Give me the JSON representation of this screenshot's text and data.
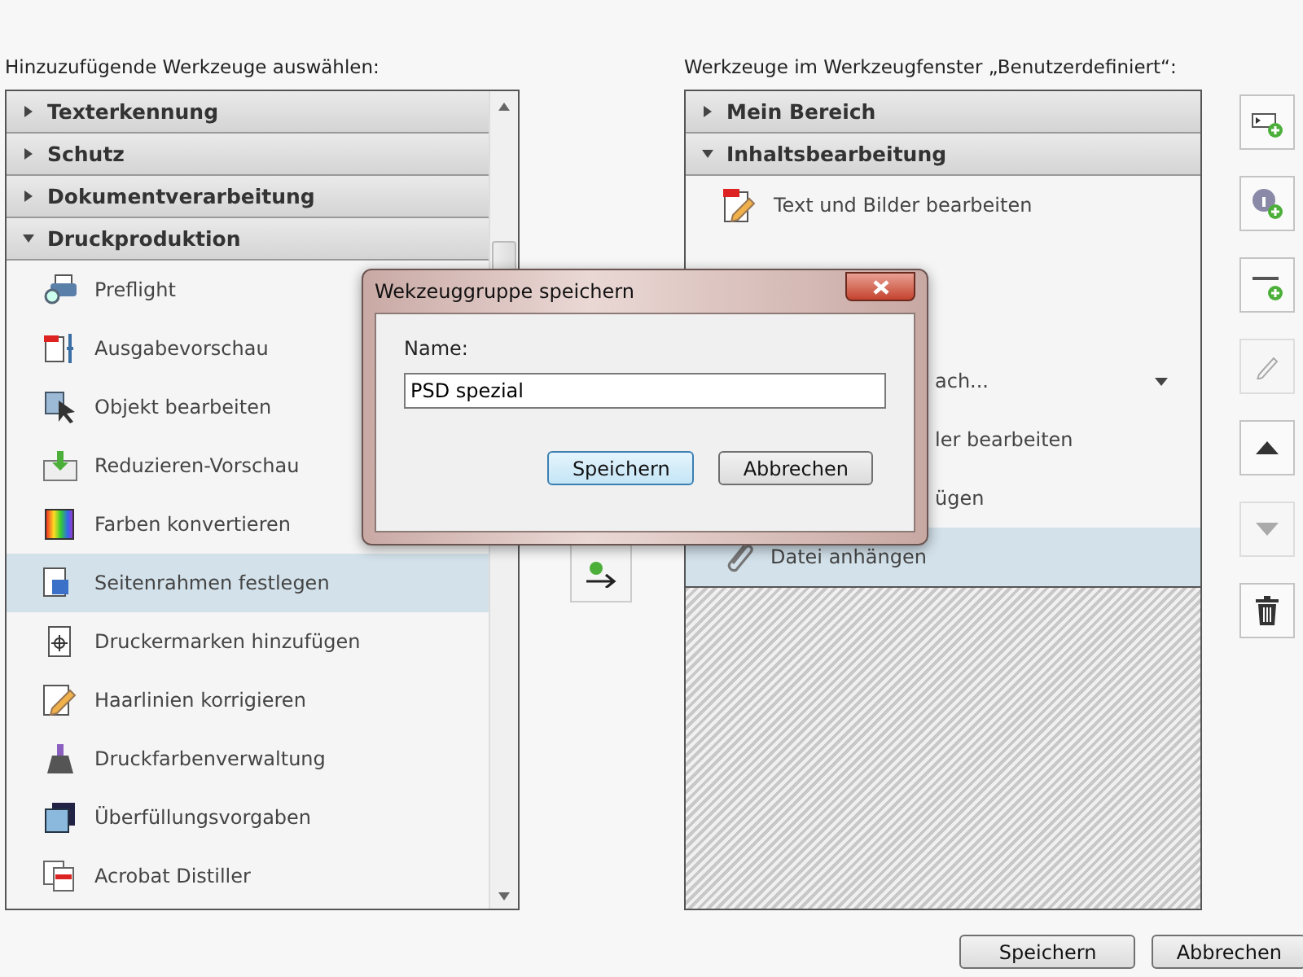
{
  "left": {
    "label": "Hinzuzufügende Werkzeuge auswählen:",
    "groups": [
      {
        "label": "Texterkennung",
        "expanded": false
      },
      {
        "label": "Schutz",
        "expanded": false
      },
      {
        "label": "Dokumentverarbeitung",
        "expanded": false
      },
      {
        "label": "Druckproduktion",
        "expanded": true
      }
    ],
    "items": [
      {
        "label": "Preflight",
        "selected": false
      },
      {
        "label": "Ausgabevorschau",
        "selected": false
      },
      {
        "label": "Objekt bearbeiten",
        "selected": false
      },
      {
        "label": "Reduzieren-Vorschau",
        "selected": false
      },
      {
        "label": "Farben konvertieren",
        "selected": false
      },
      {
        "label": "Seitenrahmen festlegen",
        "selected": true
      },
      {
        "label": "Druckermarken hinzufügen",
        "selected": false
      },
      {
        "label": "Haarlinien korrigieren",
        "selected": false
      },
      {
        "label": "Druckfarbenverwaltung",
        "selected": false
      },
      {
        "label": "Überfüllungsvorgaben",
        "selected": false
      },
      {
        "label": "Acrobat Distiller",
        "selected": false
      }
    ]
  },
  "right": {
    "label": "Werkzeuge im Werkzeugfenster „Benutzerdefiniert“:",
    "groups": [
      {
        "label": "Mein Bereich",
        "expanded": false
      },
      {
        "label": "Inhaltsbearbeitung",
        "expanded": true
      }
    ],
    "items": [
      {
        "kind": "full",
        "label": "Text und Bilder bearbeiten",
        "selected": false
      },
      {
        "kind": "covered",
        "selected": false
      },
      {
        "kind": "covered",
        "selected": false
      },
      {
        "kind": "partial",
        "label": "ach...",
        "dropdown": true,
        "selected": false
      },
      {
        "kind": "partial",
        "label": "ler bearbeiten",
        "selected": false
      },
      {
        "kind": "partial",
        "label": "ügen",
        "selected": false
      },
      {
        "kind": "full",
        "label": "Datei anhängen",
        "selected": true
      }
    ]
  },
  "side_buttons": [
    {
      "kind": "add-panel",
      "disabled": false
    },
    {
      "kind": "add-info",
      "disabled": false
    },
    {
      "kind": "add-divider",
      "disabled": false
    },
    {
      "kind": "rename",
      "disabled": true
    },
    {
      "kind": "up",
      "disabled": false
    },
    {
      "kind": "down",
      "disabled": true
    },
    {
      "kind": "delete",
      "disabled": false
    }
  ],
  "dialog": {
    "title": "Wekzeuggruppe speichern",
    "field_label": "Name:",
    "value": "PSD spezial",
    "buttons": [
      {
        "label": "Speichern",
        "default": true
      },
      {
        "label": "Abbrechen",
        "default": false
      }
    ]
  },
  "footer_buttons": [
    "Speichern",
    "Abbrechen"
  ]
}
